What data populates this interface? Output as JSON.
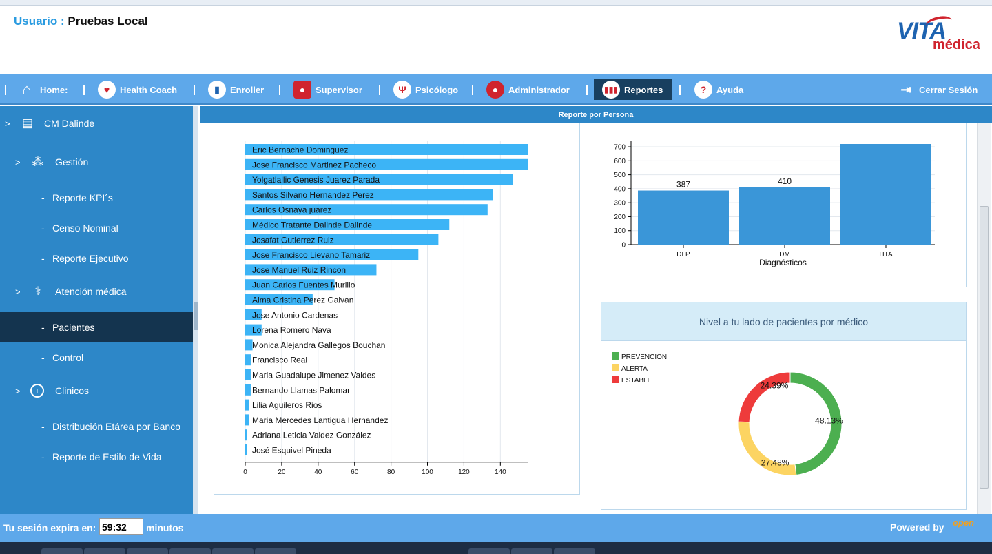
{
  "header": {
    "user_label": "Usuario :",
    "user_name": "Pruebas Local",
    "logo_vita": "VITA",
    "logo_medica": "médica"
  },
  "nav": {
    "items": [
      {
        "label": "Home:",
        "icon": "home-icon"
      },
      {
        "label": "Health Coach",
        "icon": "heartbeat-icon"
      },
      {
        "label": "Enroller",
        "icon": "book-icon"
      },
      {
        "label": "Supervisor",
        "icon": "person-icon"
      },
      {
        "label": "Psicólogo",
        "icon": "psi-icon"
      },
      {
        "label": "Administrador",
        "icon": "admin-icon"
      },
      {
        "label": "Reportes",
        "icon": "bar-chart-icon"
      },
      {
        "label": "Ayuda",
        "icon": "help-icon"
      }
    ],
    "logout": "Cerrar Sesión",
    "active": "Reportes"
  },
  "sidebar": {
    "items": [
      {
        "label": "CM Dalinde",
        "icon": "clipboard-icon",
        "level": 0
      },
      {
        "label": "Gestión",
        "icon": "org-chart-icon",
        "level": 1
      },
      {
        "label": "Reporte KPI´s",
        "level": 2
      },
      {
        "label": "Censo Nominal",
        "level": 2
      },
      {
        "label": "Reporte Ejecutivo",
        "level": 2
      },
      {
        "label": "Atención médica",
        "icon": "stethoscope-icon",
        "level": 1
      },
      {
        "label": "Pacientes",
        "level": 2,
        "active": true
      },
      {
        "label": "Control",
        "level": 2
      },
      {
        "label": "Clinicos",
        "icon": "plus-circle-icon",
        "level": 1
      },
      {
        "label": "Distribución Etárea por Banco",
        "level": 2
      },
      {
        "label": "Reporte de Estilo de Vida",
        "level": 2
      }
    ]
  },
  "content": {
    "title": "Reporte por Persona",
    "pie_panel_title": "Nivel a tu lado de pacientes por médico"
  },
  "footer": {
    "session_label": "Tu sesión expira en:",
    "timer": "59:32",
    "minutes_label": "minutos",
    "powered_by": "Powered by",
    "brand": "open"
  },
  "colors": {
    "nav_bg": "#5ea8ea",
    "sidebar_bg": "#2d87c8",
    "active_bg": "#14344f",
    "bar": "#3cb4f6",
    "diag_bar": "#3a96d8",
    "prevencion": "#4caf50",
    "alerta": "#fcd462",
    "estable": "#ee3b3b"
  },
  "chart_data": [
    {
      "type": "bar",
      "orientation": "horizontal",
      "categories": [
        "Eric Bernache Dominguez",
        "Jose Francisco Martinez Pacheco",
        "Yolgatlallic Genesis Juarez Parada",
        "Santos Silvano Hernandez Perez",
        "Carlos Osnaya juarez",
        "Médico Tratante Dalinde Dalinde",
        "Josafat Gutierrez Ruiz",
        "Jose Francisco Lievano Tamariz",
        "Jose Manuel Ruiz Rincon",
        "Juan Carlos Fuentes Murillo",
        "Alma Cristina Perez Galvan",
        "Jose Antonio Cardenas",
        "Lorena Romero Nava",
        "Monica Alejandra Gallegos Bouchan",
        "Francisco Real",
        "Maria Guadalupe Jimenez Valdes",
        "Bernando Llamas Palomar",
        "Lilia Aguileros Rios",
        "Maria Mercedes Lantigua Hernandez",
        "Adriana Leticia Valdez González",
        "José Esquivel Pineda"
      ],
      "values": [
        155,
        155,
        147,
        136,
        133,
        112,
        106,
        95,
        72,
        49,
        37,
        9,
        9,
        4,
        3,
        3,
        3,
        2,
        2,
        1,
        1
      ],
      "xlim": [
        0,
        155
      ],
      "xticks": [
        0,
        20,
        40,
        60,
        80,
        100,
        120,
        140
      ],
      "grid": true
    },
    {
      "type": "bar",
      "categories": [
        "DLP",
        "DM",
        "HTA"
      ],
      "values": [
        387,
        410,
        720
      ],
      "data_labels": [
        "387",
        "410",
        ""
      ],
      "xlabel": "Diagnósticos",
      "ylim": [
        0,
        720
      ],
      "yticks": [
        0,
        100,
        200,
        300,
        400,
        500,
        600,
        700
      ],
      "grid": true
    },
    {
      "type": "pie",
      "donut": true,
      "title": "Nivel a tu lado de pacientes por médico",
      "labels": [
        "PREVENCIÓN",
        "ALERTA",
        "ESTABLE"
      ],
      "values": [
        48.13,
        27.48,
        24.39
      ],
      "value_labels": [
        "48.13%",
        "27.48%",
        "24.39%"
      ],
      "legend": "top-left"
    }
  ]
}
